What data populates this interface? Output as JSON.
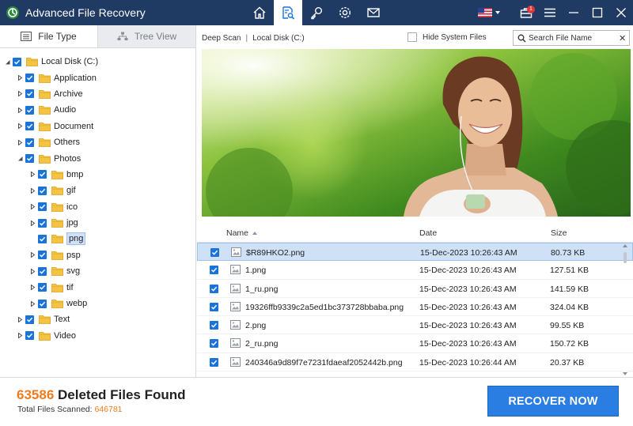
{
  "app": {
    "title": "Advanced File Recovery",
    "language_flag": "US"
  },
  "nav_tabs": [
    {
      "name": "home-icon",
      "active": false
    },
    {
      "name": "scan-icon",
      "active": true
    },
    {
      "name": "key-icon",
      "active": false
    },
    {
      "name": "settings-icon",
      "active": false
    },
    {
      "name": "mail-icon",
      "active": false
    }
  ],
  "notification_count": "1",
  "left_panel": {
    "tabs": [
      {
        "label": "File Type",
        "active": true
      },
      {
        "label": "Tree View",
        "active": false
      }
    ],
    "tree": [
      {
        "label": "Local Disk (C:)",
        "depth": 0,
        "expander": "open",
        "checked": true
      },
      {
        "label": "Application",
        "depth": 1,
        "expander": "closed",
        "checked": true
      },
      {
        "label": "Archive",
        "depth": 1,
        "expander": "closed",
        "checked": true
      },
      {
        "label": "Audio",
        "depth": 1,
        "expander": "closed",
        "checked": true
      },
      {
        "label": "Document",
        "depth": 1,
        "expander": "closed",
        "checked": true
      },
      {
        "label": "Others",
        "depth": 1,
        "expander": "closed",
        "checked": true
      },
      {
        "label": "Photos",
        "depth": 1,
        "expander": "open",
        "checked": true
      },
      {
        "label": "bmp",
        "depth": 2,
        "expander": "closed",
        "checked": true
      },
      {
        "label": "gif",
        "depth": 2,
        "expander": "closed",
        "checked": true
      },
      {
        "label": "ico",
        "depth": 2,
        "expander": "closed",
        "checked": true
      },
      {
        "label": "jpg",
        "depth": 2,
        "expander": "closed",
        "checked": true
      },
      {
        "label": "png",
        "depth": 2,
        "expander": "none",
        "checked": true,
        "selected": true
      },
      {
        "label": "psp",
        "depth": 2,
        "expander": "closed",
        "checked": true
      },
      {
        "label": "svg",
        "depth": 2,
        "expander": "closed",
        "checked": true
      },
      {
        "label": "tif",
        "depth": 2,
        "expander": "closed",
        "checked": true
      },
      {
        "label": "webp",
        "depth": 2,
        "expander": "closed",
        "checked": true
      },
      {
        "label": "Text",
        "depth": 1,
        "expander": "closed",
        "checked": true
      },
      {
        "label": "Video",
        "depth": 1,
        "expander": "closed",
        "checked": true
      }
    ]
  },
  "content": {
    "breadcrumb": [
      "Deep Scan",
      "Local Disk (C:)"
    ],
    "hide_system_files": {
      "label": "Hide System Files",
      "checked": false
    },
    "search": {
      "placeholder": "Search File Name"
    }
  },
  "table": {
    "columns": {
      "name": "Name",
      "date": "Date",
      "size": "Size"
    },
    "sort": "name-ascending",
    "rows": [
      {
        "name": "$R89HKO2.png",
        "date": "15-Dec-2023 10:26:43 AM",
        "size": "80.73 KB",
        "checked": true,
        "selected": true
      },
      {
        "name": "1.png",
        "date": "15-Dec-2023 10:26:43 AM",
        "size": "127.51 KB",
        "checked": true
      },
      {
        "name": "1_ru.png",
        "date": "15-Dec-2023 10:26:43 AM",
        "size": "141.59 KB",
        "checked": true
      },
      {
        "name": "19326ffb9339c2a5ed1bc373728bbaba.png",
        "date": "15-Dec-2023 10:26:43 AM",
        "size": "324.04 KB",
        "checked": true
      },
      {
        "name": "2.png",
        "date": "15-Dec-2023 10:26:43 AM",
        "size": "99.55 KB",
        "checked": true
      },
      {
        "name": "2_ru.png",
        "date": "15-Dec-2023 10:26:43 AM",
        "size": "150.72 KB",
        "checked": true
      },
      {
        "name": "240346a9d89f7e7231fdaeaf2052442b.png",
        "date": "15-Dec-2023 10:26:44 AM",
        "size": "20.37 KB",
        "checked": true
      }
    ]
  },
  "footer": {
    "deleted_count": "63586",
    "deleted_label": "Deleted Files Found",
    "scanned_label": "Total Files Scanned:",
    "scanned_count": "646781",
    "recover_label": "RECOVER NOW"
  },
  "colors": {
    "titlebar": "#1f3a63",
    "accent_blue": "#1a73d9",
    "button_blue": "#2a7de1",
    "highlight_orange": "#f07b1f",
    "selection": "#cfe1f7"
  }
}
